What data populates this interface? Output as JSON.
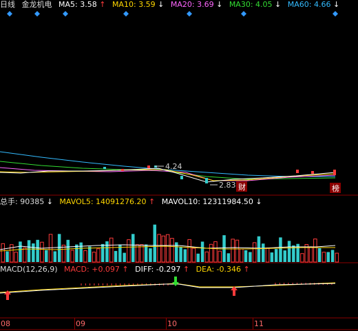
{
  "header": {
    "period": "日线",
    "stock": "金龙机电",
    "ma": [
      {
        "label": "MA5: 3.58",
        "arrow": "↑",
        "color": "#ffffff"
      },
      {
        "label": "MA10: 3.59",
        "arrow": "↓",
        "color": "#ffd700"
      },
      {
        "label": "MA20: 3.69",
        "arrow": "↓",
        "color": "#ff66ff"
      },
      {
        "label": "MA30: 4.05",
        "arrow": "↓",
        "color": "#33dd33"
      },
      {
        "label": "MA60: 4.66",
        "arrow": "↓",
        "color": "#33bbff"
      }
    ]
  },
  "price_annotations": {
    "high": "4.24",
    "low": "2.83",
    "badge_cai": "财",
    "badge_bang": "榜"
  },
  "volume_header": {
    "total": "总手: 90385",
    "total_arrow": "↓",
    "mavol5": "MAVOL5: 14091276.20",
    "mavol5_arrow": "↑",
    "mavol10": "MAVOL10: 12311984.50",
    "mavol10_arrow": "↓"
  },
  "macd_header": {
    "name": "MACD(12,26,9)",
    "macd": "MACD: +0.097",
    "macd_arrow": "↑",
    "diff": "DIFF: -0.297",
    "diff_arrow": "↑",
    "dea": "DEA: -0.346",
    "dea_arrow": "↑"
  },
  "x_axis": {
    "labels": [
      "08",
      "09",
      "10",
      "11"
    ]
  },
  "colors": {
    "up": "#ff3b3b",
    "down": "#33cccc",
    "diamond": "#3399ff",
    "axis": "#8b0000"
  }
}
